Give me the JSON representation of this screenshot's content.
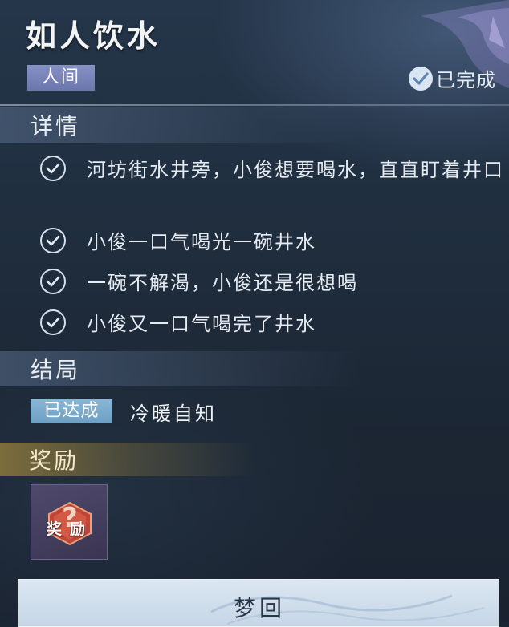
{
  "header": {
    "title": "如人饮水",
    "tag": "人间",
    "status": "已完成"
  },
  "details": {
    "section_title": "详情",
    "items": [
      "河坊街水井旁，小俊想要喝水，直直盯着井口",
      "小俊一口气喝光一碗井水",
      "一碗不解渴，小俊还是很想喝",
      "小俊又一口气喝完了井水"
    ]
  },
  "ending": {
    "section_title": "结局",
    "badge": "已达成",
    "text": "冷暖自知"
  },
  "reward": {
    "section_title": "奖励",
    "item_label": "奖励"
  },
  "action": {
    "button_label": "梦回"
  },
  "colors": {
    "tag_bg": "#7680b8",
    "badge_bg": "#7eabcc",
    "reward_bar": "#8c783c",
    "button_bg": "#d2e0ec"
  },
  "icons": [
    "check-icon",
    "completed-check-icon",
    "reward-question-icon",
    "wing-decoration"
  ]
}
